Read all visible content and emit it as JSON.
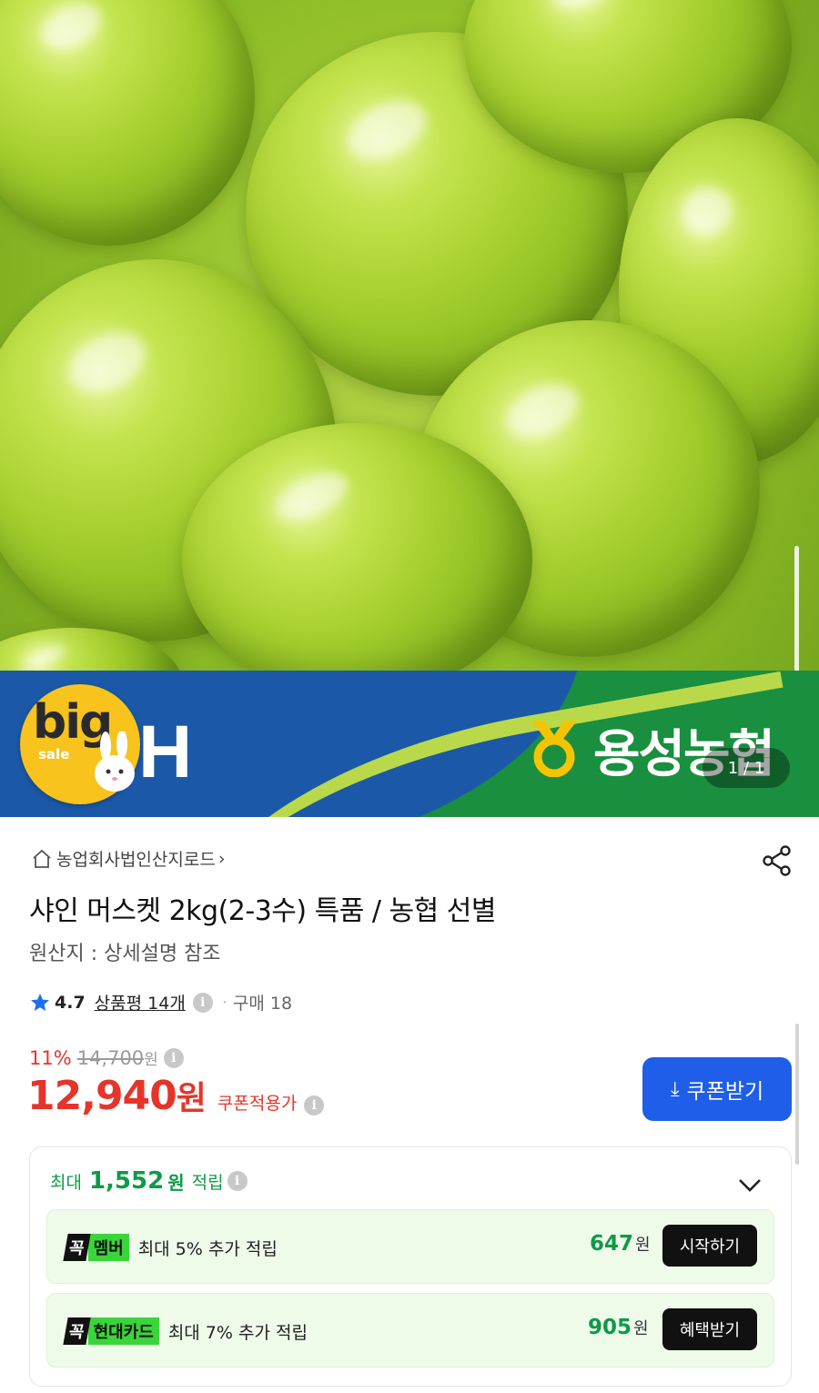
{
  "banner": {
    "badge_big": "big",
    "badge_sale": "sale",
    "h_mark": "H",
    "brand_name": "용성농협",
    "page_indicator": "1 / 1"
  },
  "product": {
    "seller": "농업회사법인산지로드",
    "title": "샤인 머스켓 2kg(2-3수) 특품 / 농협 선별",
    "origin": "원산지 : 상세설명 참조",
    "rating": "4.7",
    "review_count": "상품평 14개",
    "purchase_count": "구매 18",
    "discount_pct": "11%",
    "original_price": "14,700",
    "original_price_unit": "원",
    "price": "12,940",
    "price_unit": "원",
    "coupon_price_label": "쿠폰적용가",
    "coupon_button": "쿠폰받기"
  },
  "points": {
    "prefix": "최대",
    "amount": "1,552",
    "unit": "원",
    "suffix": "적립",
    "cards": [
      {
        "tag": "꼭",
        "name": "멤버",
        "desc": "최대 5% 추가 적립",
        "amount": "647",
        "unit": "원",
        "button": "시작하기"
      },
      {
        "tag": "꼭",
        "name": "현대카드",
        "desc": "최대 7% 추가 적립",
        "amount": "905",
        "unit": "원",
        "button": "혜택받기"
      }
    ]
  },
  "colors": {
    "price_red": "#e5352b",
    "coupon_blue": "#1e5ee8",
    "point_green": "#0f9a48",
    "banner_blue": "#1b59a8",
    "banner_green": "#1a8f3f"
  }
}
